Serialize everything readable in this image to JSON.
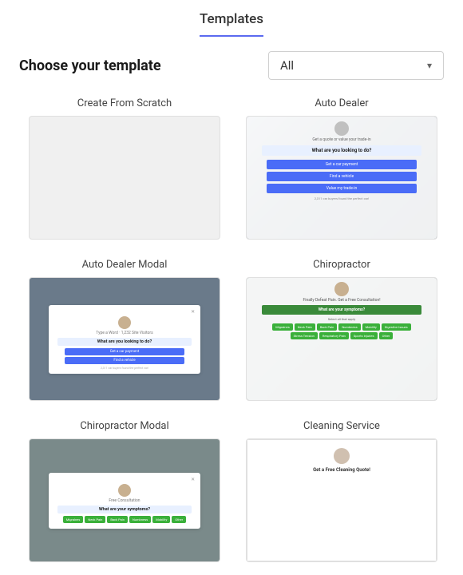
{
  "header": {
    "title": "Templates"
  },
  "toolbar": {
    "label": "Choose your template",
    "filter": {
      "value": "All",
      "placeholder": "All",
      "chevron": "▾"
    }
  },
  "templates": [
    {
      "id": "scratch",
      "name": "Create From Scratch",
      "type": "scratch"
    },
    {
      "id": "auto-dealer",
      "name": "Auto Dealer",
      "type": "auto-dealer",
      "avatar_text": "👤",
      "subtitle": "Get a quote or value your trade-in",
      "question": "What are you looking to do?",
      "btn1": "Get a car payment",
      "btn2": "Find a vehicle",
      "btn3": "Value my trade-in",
      "footer": "2,311 car buyers found the perfect car!"
    },
    {
      "id": "auto-dealer-modal",
      "name": "Auto Dealer Modal",
      "type": "auto-dealer-modal",
      "top_text": "Type a Word · 1,232 Site Visitors",
      "avatar_text": "👤",
      "question": "What are you looking to do?",
      "btn1": "Get a car payment",
      "btn2": "Find a vehicle",
      "footer": "2,311 car buyers found the perfect car!"
    },
    {
      "id": "chiropractor",
      "name": "Chiropractor",
      "type": "chiropractor",
      "avatar_text": "👤",
      "subtitle": "Finally Defeat Pain. Get a Free Consultation!",
      "question": "What are your symptoms?",
      "sublabel": "Select all that apply",
      "symptoms": [
        "Migraines",
        "Neck Pain",
        "Back Pain",
        "Numbness",
        "Mobility",
        "Digestive Issues",
        "Stress Tension",
        "Respiratory Pain",
        "Sports Injuries",
        "Other"
      ]
    },
    {
      "id": "chiropractor-modal",
      "name": "Chiropractor Modal",
      "type": "chiropractor-modal"
    },
    {
      "id": "cleaning-service",
      "name": "Cleaning Service",
      "type": "cleaning-service",
      "avatar_text": "👤",
      "title": "Get a Free Cleaning Quote!"
    }
  ]
}
